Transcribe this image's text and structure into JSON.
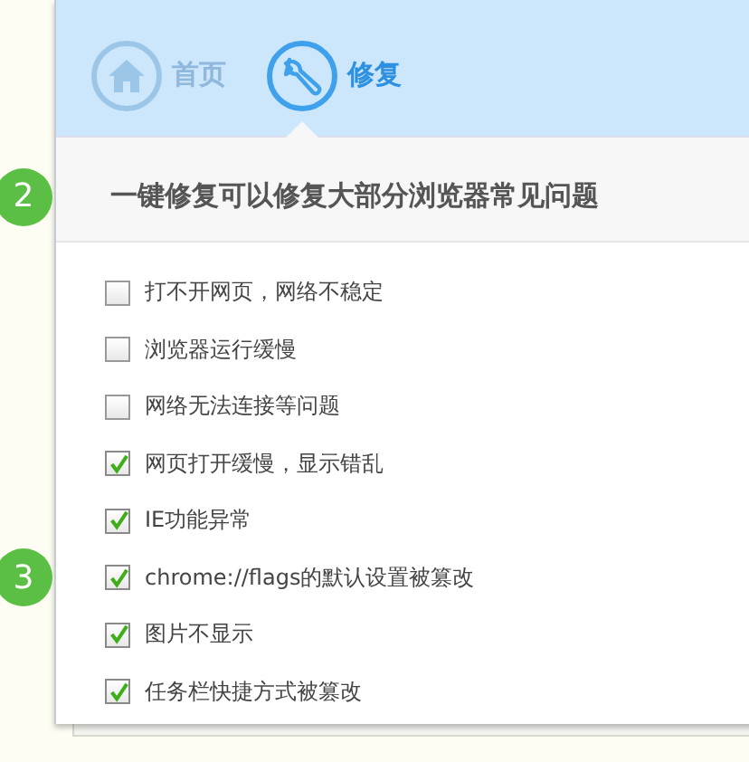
{
  "tabs": [
    {
      "label": "首页",
      "kind": "home",
      "selected": false
    },
    {
      "label": "修复",
      "kind": "wrench",
      "selected": true
    }
  ],
  "subtitle": {
    "text": "一键修复可以修复大部分浏览器常见问题",
    "step_badge": "2"
  },
  "items": [
    {
      "label": "打不开网页，网络不稳定",
      "checked": false
    },
    {
      "label": "浏览器运行缓慢",
      "checked": false
    },
    {
      "label": "网络无法连接等问题",
      "checked": false
    },
    {
      "label": "网页打开缓慢，显示错乱",
      "checked": true
    },
    {
      "label": "IE功能异常",
      "checked": true
    },
    {
      "label": "chrome://flags的默认设置被篡改",
      "checked": true,
      "step_badge": "3"
    },
    {
      "label": "图片不显示",
      "checked": true
    },
    {
      "label": "任务栏快捷方式被篡改",
      "checked": true
    }
  ]
}
